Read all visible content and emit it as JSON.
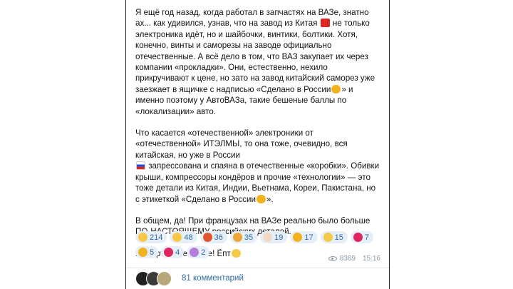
{
  "post": {
    "p1_a": "Я ещё год назад, когда работал в запчастях на ВАЗе, знатно ах... как удивился, узнав, что на завод из Китая",
    "p1_b": "не только электроника идёт, но и шайбочки, винтики, болтики. Хотя, конечно, винты и саморезы на заводе официально отечественные. А всё дело в том, что ВАЗ закупает их через компании «прокладки». Они, естественно, нехило прикручивают к цене, но зато на завод китайский саморез уже заезжает в ящичке с надписью «Сделано в России",
    "p1_c": "» и именно поэтому у АвтоВАЗа, такие бешеные баллы по «локализации» авто.",
    "p2_a": "Что касается «отечественной» электроники от «отечественной» ИТЭЛМЫ, то она тоже, очевидно, вся китайская, но уже в России",
    "p2_b": "запрессована и спаяна в отечественные «коробки». Обивки крыши, компрессоры кондёров и прочие «технологии» — это тоже детали из Китая, Индии, Вьетнама, Кореи, Пакистана, но с этикеткой «Сделано в России",
    "p2_c": "».",
    "p3": "В общем, да! При французах на ВАЗе реально было больше ПО-НАСТОЯЩЕМУ российских деталей.",
    "p4": "Импортозамещение! Ёпт"
  },
  "reactions": [
    {
      "icon": "grin-face-icon",
      "color": "#f7c948",
      "count": "214"
    },
    {
      "icon": "scream-face-icon",
      "color": "#f7c948",
      "count": "48"
    },
    {
      "icon": "angry-face-icon",
      "color": "#e2552c",
      "count": "36"
    },
    {
      "icon": "mind-blown-icon",
      "color": "#f0a636",
      "count": "35"
    },
    {
      "icon": "clown-face-icon",
      "color": "#f3d9c4",
      "count": "19"
    },
    {
      "icon": "thumbs-up-icon",
      "color": "#f2b21d",
      "count": "17"
    },
    {
      "icon": "rofl-face-icon",
      "color": "#f7c948",
      "count": "15"
    },
    {
      "icon": "hundred-icon",
      "color": "#e0245e",
      "count": "7"
    },
    {
      "icon": "thumbs-down-icon",
      "color": "#f2b21d",
      "count": "5"
    },
    {
      "icon": "red-heart-icon",
      "color": "#e0245e",
      "count": "4"
    },
    {
      "icon": "unicorn-icon",
      "color": "#b57edc",
      "count": "2"
    }
  ],
  "meta": {
    "views": "8369",
    "time": "15:16"
  },
  "comments": {
    "label": "81 комментарий"
  }
}
